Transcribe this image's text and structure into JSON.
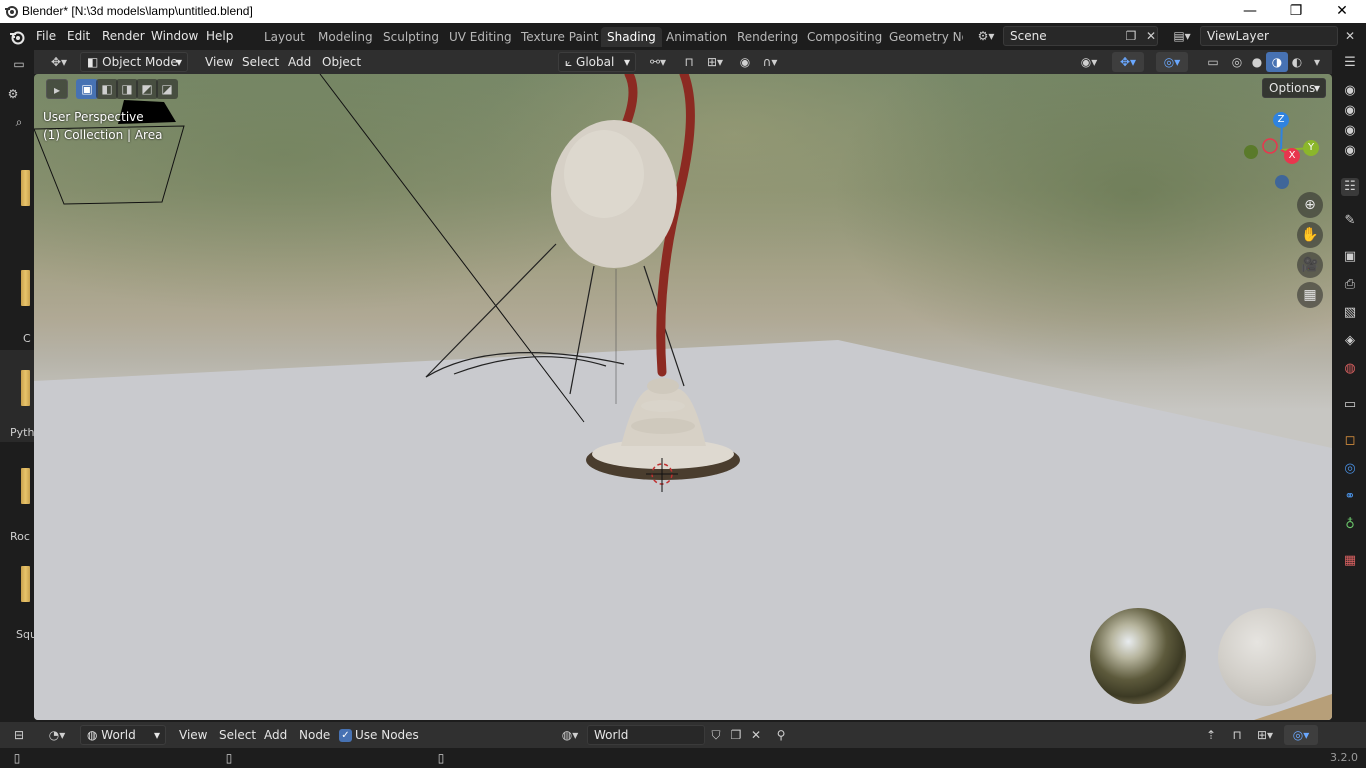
{
  "window": {
    "title": "Blender* [N:\\3d models\\lamp\\untitled.blend]",
    "minimize_glyph": "—",
    "restore_glyph": "❐",
    "close_glyph": "✕"
  },
  "menu": {
    "items": [
      "File",
      "Edit",
      "Render",
      "Window",
      "Help"
    ]
  },
  "workspaces": {
    "tabs": [
      "Layout",
      "Modeling",
      "Sculpting",
      "UV Editing",
      "Texture Paint",
      "Shading",
      "Animation",
      "Rendering",
      "Compositing",
      "Geometry Noc"
    ],
    "active": "Shading"
  },
  "scene": {
    "name": "Scene"
  },
  "view_layer": {
    "name": "ViewLayer"
  },
  "viewport_header": {
    "mode": "Object Mode",
    "menus": [
      "View",
      "Select",
      "Add",
      "Object"
    ],
    "transform_orientation": "Global",
    "options_label": "Options"
  },
  "viewport": {
    "perspective_label": "User Perspective",
    "collection_label": "(1) Collection | Area",
    "gizmo": {
      "z": "Z",
      "y": "Y",
      "x": "X"
    }
  },
  "sidebar": {
    "tabs": [
      {
        "label": ""
      },
      {
        "label": "C"
      },
      {
        "label": "Pyth"
      },
      {
        "label": "Roc"
      },
      {
        "label": "Squ"
      }
    ]
  },
  "bottom_header": {
    "world_type": "World",
    "menus": [
      "View",
      "Select",
      "Add",
      "Node"
    ],
    "use_nodes_label": "Use Nodes",
    "use_nodes_checked": true,
    "world_name": "World"
  },
  "status": {
    "version": "3.2.0"
  },
  "colors": {
    "accent": "#4772b3",
    "active_tab": "#303030",
    "lamp_arm": "#8c2a22",
    "gizmo_x": "#e8364e",
    "gizmo_y": "#8bb62b",
    "gizmo_z": "#2f83e0"
  }
}
